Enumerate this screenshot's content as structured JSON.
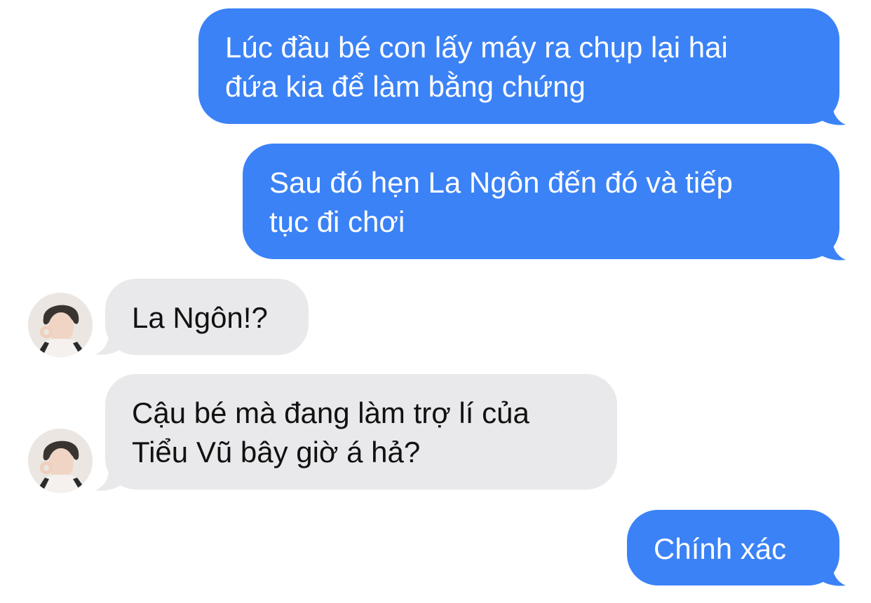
{
  "colors": {
    "sent_bubble": "#3b82f6",
    "received_bubble": "#e9e9eb",
    "sent_text": "#ffffff",
    "received_text": "#111111"
  },
  "messages": [
    {
      "direction": "sent",
      "lines": [
        "Lúc đầu bé con lấy máy ra chụp lại hai",
        "đứa kia để làm bằng chứng"
      ]
    },
    {
      "direction": "sent",
      "lines": [
        "Sau đó hẹn La Ngôn đến đó và tiếp",
        "tục đi chơi"
      ]
    },
    {
      "direction": "received",
      "lines": [
        "La Ngôn!?"
      ],
      "avatar_icon": "contact-avatar"
    },
    {
      "direction": "received",
      "lines": [
        "Cậu bé mà đang làm trợ lí của",
        "Tiểu Vũ bây giờ á hả?"
      ],
      "avatar_icon": "contact-avatar"
    },
    {
      "direction": "sent",
      "lines": [
        "Chính xác"
      ]
    }
  ]
}
